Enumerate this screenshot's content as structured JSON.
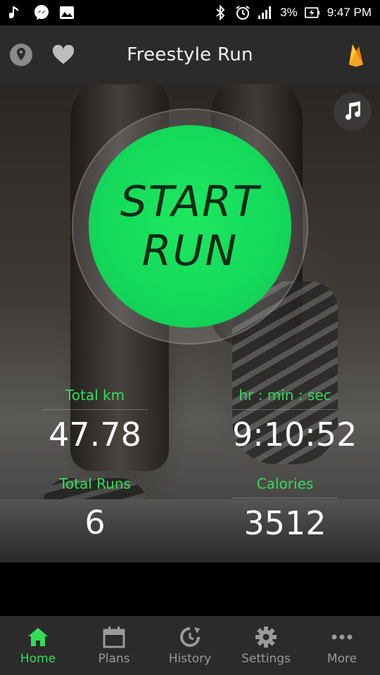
{
  "status_bar": {
    "battery": "3%",
    "time": "9:47 PM"
  },
  "app_bar": {
    "title": "Freestyle Run"
  },
  "start_button": {
    "line1": "START",
    "line2": "RUN"
  },
  "stats": {
    "total_km": {
      "label": "Total km",
      "value": "47.78"
    },
    "time": {
      "label": "hr : min : sec",
      "value": "9:10:52"
    },
    "total_runs": {
      "label": "Total Runs",
      "value": "6"
    },
    "calories": {
      "label": "Calories",
      "value": "3512"
    }
  },
  "bottom_nav": {
    "items": [
      {
        "label": "Home",
        "icon": "home-icon",
        "active": true
      },
      {
        "label": "Plans",
        "icon": "calendar-icon",
        "active": false
      },
      {
        "label": "History",
        "icon": "history-icon",
        "active": false
      },
      {
        "label": "Settings",
        "icon": "gear-icon",
        "active": false
      },
      {
        "label": "More",
        "icon": "more-dots-icon",
        "active": false
      }
    ]
  },
  "colors": {
    "accent_green": "#33dd5a",
    "start_green": "#14d85a",
    "bar_background": "#2b2b2b"
  }
}
